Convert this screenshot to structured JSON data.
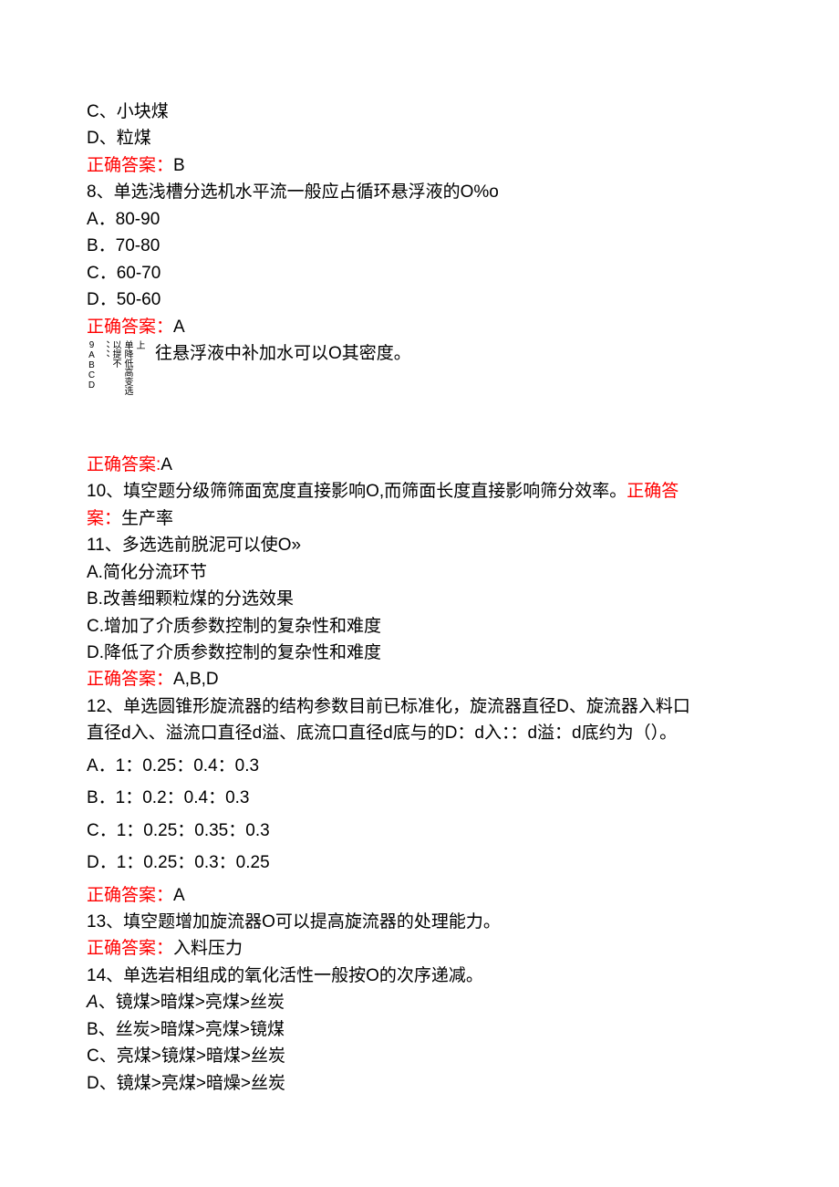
{
  "q7_continued": {
    "optC": "C、小块煤",
    "optD": "D、粒煤",
    "answer_label": "正确答案：",
    "answer_value": "B"
  },
  "q8": {
    "stem": "8、单选浅槽分选机水平流一般应占循环悬浮液的O%o",
    "optA": "A．80-90",
    "optB": "B．70-80",
    "optC": "C．60-70",
    "optD": "D．50-60",
    "answer_label": "正确答案：",
    "answer_value": "A"
  },
  "q9": {
    "col1": "9ABCD",
    "col2": "、、、、",
    "col3": "以提不",
    "col4": "单降低高变选",
    "col5": "上",
    "stem_after": "往悬浮液中补加水可以O其密度。",
    "answer_label": "正确答案:",
    "answer_value": "A"
  },
  "q10": {
    "stem_before": "10、填空题分级筛筛面宽度直接影响O,而筛面长度直接影响筛分效率。",
    "answer_label": "正确答案：",
    "answer_value": "生产率"
  },
  "q11": {
    "stem": "11、多选选前脱泥可以使O»",
    "optA": "A.简化分流环节",
    "optB": "B.改善细颗粒煤的分选效果",
    "optC": "C.增加了介质参数控制的复杂性和难度",
    "optD": "D.降低了介质参数控制的复杂性和难度",
    "answer_label": "正确答案：",
    "answer_value": "A,B,D"
  },
  "q12": {
    "stem_line1": "12、单选圆锥形旋流器的结构参数目前已标准化，旋流器直径D、旋流器入料口",
    "stem_line2": "直径d入、溢流口直径d溢、底流口直径d底与的D：d入：：d溢：d底约为（）。",
    "optA": "A．1：0.25：0.4：0.3",
    "optB": "B．1：0.2：0.4：0.3",
    "optC": "C．1：0.25：0.35：0.3",
    "optD": "D．1：0.25：0.3：0.25",
    "answer_label": "正确答案：",
    "answer_value": "A"
  },
  "q13": {
    "stem": "13、填空题增加旋流器O可以提高旋流器的处理能力。",
    "answer_label": "正确答案：",
    "answer_value": "入料压力"
  },
  "q14": {
    "stem": "14、单选岩相组成的氧化活性一般按O的次序递减。",
    "optA_label": "A",
    "optA_text": "、镜煤>暗煤>亮煤>丝炭",
    "optB": "B、丝炭>暗煤>亮煤>镜煤",
    "optC": "C、亮煤>镜煤>暗煤>丝炭",
    "optD": "D、镜煤>亮煤>暗燥>丝炭"
  }
}
